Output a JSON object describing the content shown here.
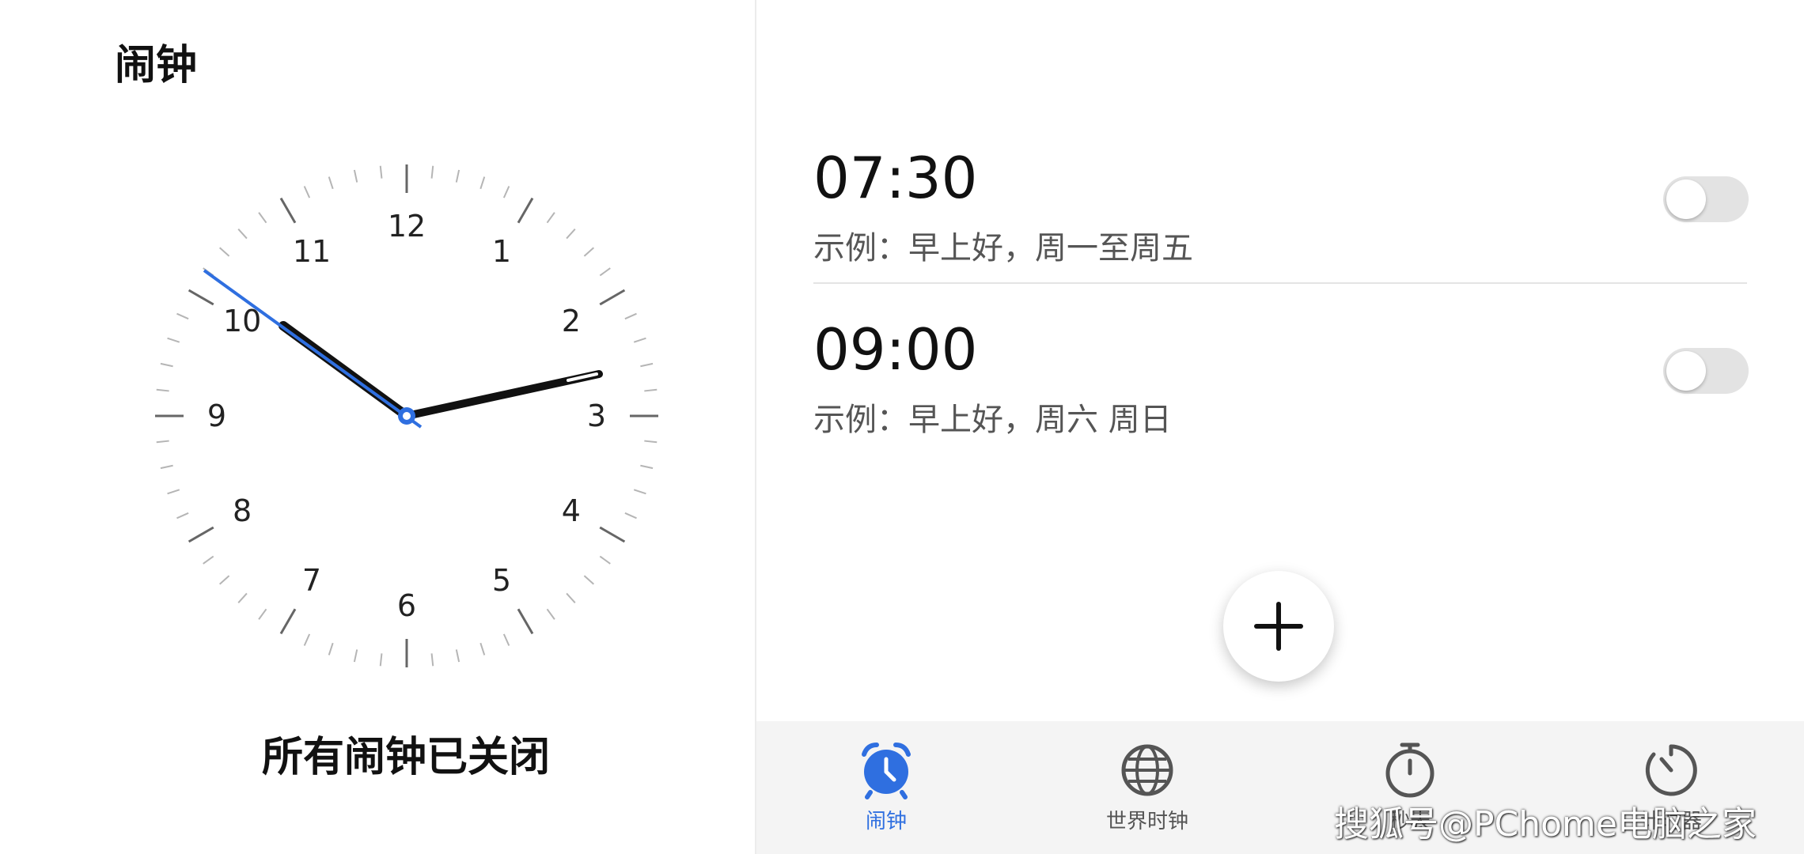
{
  "app": {
    "title": "闹钟"
  },
  "status": {
    "text": "所有闹钟已关闭"
  },
  "clock_face": {
    "numbers": [
      "12",
      "1",
      "2",
      "3",
      "4",
      "5",
      "6",
      "7",
      "8",
      "9",
      "10",
      "11"
    ],
    "shown_time": "10:15",
    "hand_color": "#111111",
    "second_hand_color": "#2f6fe0"
  },
  "alarms": [
    {
      "time": "07:30",
      "label": "示例：早上好，周一至周五",
      "enabled": false
    },
    {
      "time": "09:00",
      "label": "示例：早上好，周六 周日",
      "enabled": false
    }
  ],
  "fab": {
    "icon": "plus-icon"
  },
  "bottom_nav": {
    "items": [
      {
        "label": "闹钟",
        "icon": "alarm-clock-icon",
        "active": true
      },
      {
        "label": "世界时钟",
        "icon": "globe-icon",
        "active": false
      },
      {
        "label": "秒表",
        "icon": "stopwatch-icon",
        "active": false
      },
      {
        "label": "计时器",
        "icon": "timer-icon",
        "active": false
      }
    ]
  },
  "watermark": {
    "text": "搜狐号@PChome电脑之家"
  },
  "colors": {
    "accent": "#2f6fe0",
    "toggle_off": "#e3e3e3",
    "text_secondary": "#555555"
  }
}
